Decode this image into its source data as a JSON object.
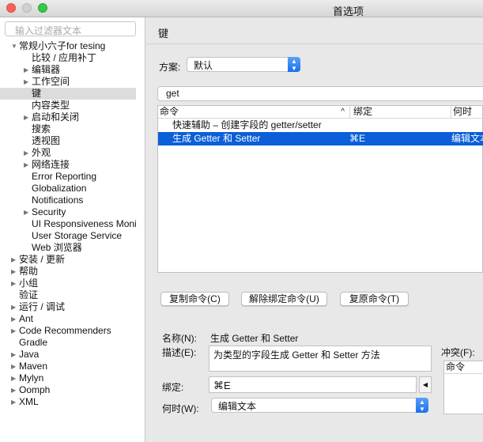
{
  "window": {
    "title": "首选项"
  },
  "sidebar": {
    "filter_placeholder": "输入过滤器文本",
    "items": [
      {
        "label": "常规小六子for tesing",
        "level": 0,
        "expander": "expanded"
      },
      {
        "label": "比较 / 应用补丁",
        "level": 1,
        "expander": "none"
      },
      {
        "label": "编辑器",
        "level": 1,
        "expander": "collapsed"
      },
      {
        "label": "工作空间",
        "level": 1,
        "expander": "collapsed"
      },
      {
        "label": "键",
        "level": 1,
        "expander": "none",
        "selected": true
      },
      {
        "label": "内容类型",
        "level": 1,
        "expander": "none"
      },
      {
        "label": "启动和关闭",
        "level": 1,
        "expander": "collapsed"
      },
      {
        "label": "搜索",
        "level": 1,
        "expander": "none"
      },
      {
        "label": "透视图",
        "level": 1,
        "expander": "none"
      },
      {
        "label": "外观",
        "level": 1,
        "expander": "collapsed"
      },
      {
        "label": "网络连接",
        "level": 1,
        "expander": "collapsed"
      },
      {
        "label": "Error Reporting",
        "level": 1,
        "expander": "none"
      },
      {
        "label": "Globalization",
        "level": 1,
        "expander": "none"
      },
      {
        "label": "Notifications",
        "level": 1,
        "expander": "none"
      },
      {
        "label": "Security",
        "level": 1,
        "expander": "collapsed"
      },
      {
        "label": "UI Responsiveness Monit",
        "level": 1,
        "expander": "none"
      },
      {
        "label": "User Storage Service",
        "level": 1,
        "expander": "none"
      },
      {
        "label": "Web 浏览器",
        "level": 1,
        "expander": "none"
      },
      {
        "label": "安装 / 更新",
        "level": 0,
        "expander": "collapsed"
      },
      {
        "label": "帮助",
        "level": 0,
        "expander": "collapsed"
      },
      {
        "label": "小组",
        "level": 0,
        "expander": "collapsed"
      },
      {
        "label": "验证",
        "level": 0,
        "expander": "none"
      },
      {
        "label": "运行 / 调试",
        "level": 0,
        "expander": "collapsed"
      },
      {
        "label": "Ant",
        "level": 0,
        "expander": "collapsed"
      },
      {
        "label": "Code Recommenders",
        "level": 0,
        "expander": "collapsed"
      },
      {
        "label": "Gradle",
        "level": 0,
        "expander": "none"
      },
      {
        "label": "Java",
        "level": 0,
        "expander": "collapsed"
      },
      {
        "label": "Maven",
        "level": 0,
        "expander": "collapsed"
      },
      {
        "label": "Mylyn",
        "level": 0,
        "expander": "collapsed"
      },
      {
        "label": "Oomph",
        "level": 0,
        "expander": "collapsed"
      },
      {
        "label": "XML",
        "level": 0,
        "expander": "collapsed"
      }
    ]
  },
  "main": {
    "title": "键",
    "scheme_label": "方案:",
    "scheme_value": "默认",
    "search_value": "get",
    "table": {
      "columns": [
        "命令",
        "绑定",
        "何时"
      ],
      "sort_indicator": "^",
      "rows": [
        {
          "command": "快速辅助 – 创建字段的 getter/setter",
          "binding": "",
          "when": ""
        },
        {
          "command": "生成 Getter 和 Setter",
          "binding": "⌘E",
          "when": "编辑文本",
          "selected": true
        }
      ]
    },
    "buttons": {
      "copy": "复制命令(C)",
      "unbind": "解除绑定命令(U)",
      "restore": "复原命令(T)"
    },
    "details": {
      "name_label": "名称(N):",
      "name_value": "生成 Getter 和 Setter",
      "desc_label": "描述(E):",
      "desc_value": "为类型的字段生成 Getter 和 Setter 方法",
      "binding_label": "绑定:",
      "binding_value": "⌘E",
      "when_label": "何时(W):",
      "when_value": "编辑文本",
      "conflicts_label": "冲突(F):",
      "conflicts_column": "命令"
    }
  },
  "colors": {
    "selection": "#0b5fd8",
    "accent": "#1a6ff0"
  }
}
